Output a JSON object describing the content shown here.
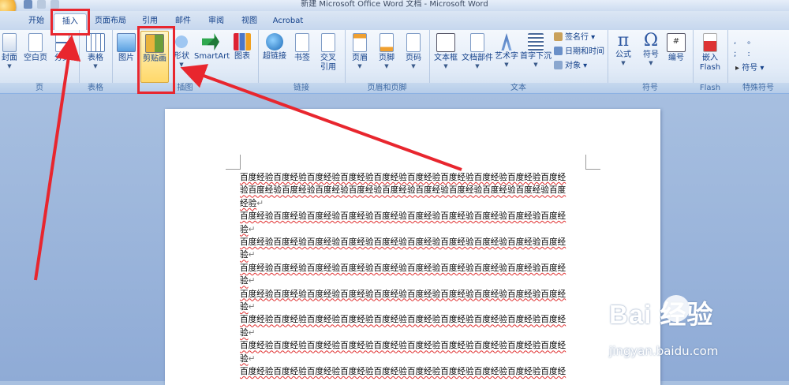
{
  "window": {
    "title": "新建 Microsoft Office Word 文档 - Microsoft Word"
  },
  "tabs": [
    "开始",
    "插入",
    "页面布局",
    "引用",
    "邮件",
    "审阅",
    "视图",
    "Acrobat"
  ],
  "active_tab": "插入",
  "ribbon": {
    "pages": {
      "label": "页",
      "buttons": [
        "封面",
        "空白页",
        "分页"
      ]
    },
    "table": {
      "label": "表格",
      "buttons": [
        "表格"
      ]
    },
    "illustrations": {
      "label": "插图",
      "buttons": [
        "图片",
        "剪贴画",
        "形状",
        "SmartArt",
        "图表"
      ]
    },
    "links": {
      "label": "链接",
      "buttons": [
        "超链接",
        "书签",
        "交叉引用"
      ]
    },
    "header_footer": {
      "label": "页眉和页脚",
      "buttons": [
        "页眉",
        "页脚",
        "页码"
      ]
    },
    "text": {
      "label": "文本",
      "buttons": [
        "文本框",
        "文档部件",
        "艺术字",
        "首字下沉"
      ],
      "small": [
        "签名行",
        "日期和时间",
        "对象"
      ]
    },
    "symbols": {
      "label": "符号",
      "buttons": [
        "公式",
        "符号",
        "编号"
      ]
    },
    "flash": {
      "label": "Flash",
      "buttons": [
        "嵌入Flash"
      ]
    },
    "special": {
      "label": "特殊符号",
      "small": [
        "符号"
      ]
    }
  },
  "document": {
    "lines": [
      "百度经验百度经验百度经验百度经验百度经验百度经验百度经验百度经验百度经验百度经",
      "验百度经验百度经验百度经验百度经验百度经验百度经验百度经验百度经验百度经验百度",
      "经验",
      "百度经验百度经验百度经验百度经验百度经验百度经验百度经验百度经验百度经验百度经",
      "验",
      "百度经验百度经验百度经验百度经验百度经验百度经验百度经验百度经验百度经验百度经",
      "验",
      "百度经验百度经验百度经验百度经验百度经验百度经验百度经验百度经验百度经验百度经",
      "验",
      "百度经验百度经验百度经验百度经验百度经验百度经验百度经验百度经验百度经验百度经",
      "验",
      "百度经验百度经验百度经验百度经验百度经验百度经验百度经验百度经验百度经验百度经",
      "验",
      "百度经验百度经验百度经验百度经验百度经验百度经验百度经验百度经验百度经验百度经",
      "验",
      "百度经验百度经验百度经验百度经验百度经验百度经验百度经验百度经验百度经验百度经"
    ],
    "paragraph_mark": "↵"
  },
  "watermark": {
    "logo": "Bai  经验",
    "url": "jingyan.baidu.com"
  },
  "colors": {
    "highlight": "#e8262e",
    "accent": "#15428b"
  }
}
